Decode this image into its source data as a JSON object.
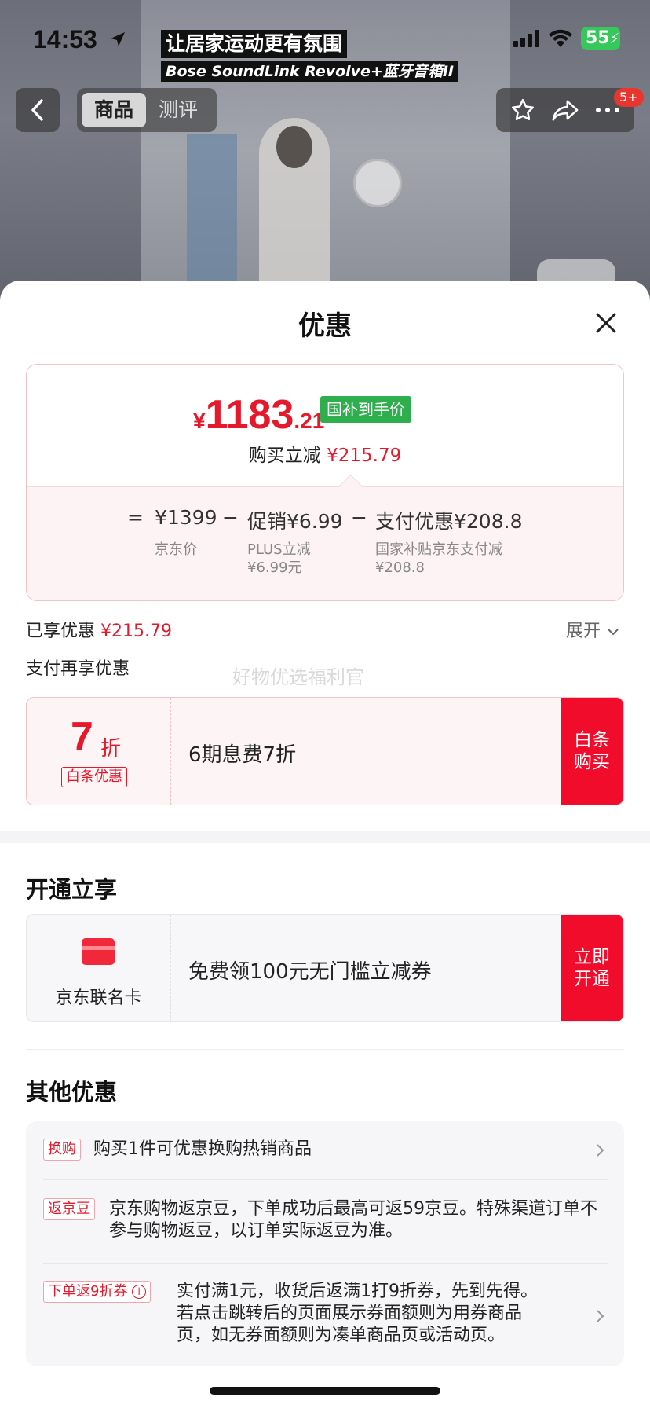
{
  "status_bar": {
    "time": "14:53",
    "battery": "55"
  },
  "video_caption": {
    "line1": "让居家运动更有氛围",
    "line2": "Bose SoundLink Revolve+蓝牙音箱II"
  },
  "top_nav": {
    "tabs": [
      {
        "label": "商品",
        "active": true
      },
      {
        "label": "测评",
        "active": false
      }
    ],
    "badge": "5+"
  },
  "sheet": {
    "title": "优惠",
    "price_card": {
      "currency": "¥",
      "price_int": "1183",
      "price_dec": ".21",
      "tag": "国补到手价",
      "reduce_label": "购买立减",
      "reduce_value": "¥215.79",
      "eq": "=",
      "jd_price": "¥1399",
      "jd_price_label": "京东价",
      "minus1": "−",
      "promo": "促销¥6.99",
      "promo_label_1": "PLUS立减",
      "promo_label_2": "¥6.99元",
      "minus2": "−",
      "pay": "支付优惠¥208.8",
      "pay_label_1": "国家补贴京东支付减",
      "pay_label_2": "¥208.8"
    },
    "enjoyed_label": "已享优惠",
    "enjoyed_value": "¥215.79",
    "expand": "展开",
    "pay_more": "支付再享优惠",
    "watermark": "好物优选福利官",
    "baitiao": {
      "discount": "7",
      "unit": "折",
      "tag": "白条优惠",
      "text": "6期息费7折",
      "button_line1": "白条",
      "button_line2": "购买"
    },
    "open_title": "开通立享",
    "cobrand": {
      "label": "京东联名卡",
      "text": "免费领100元无门槛立减券",
      "button_line1": "立即",
      "button_line2": "开通"
    },
    "other_title": "其他优惠",
    "other_items": [
      {
        "tag": "换购",
        "text": "购买1件可优惠换购热销商品"
      },
      {
        "tag": "返京豆",
        "text": "京东购物返京豆，下单成功后最高可返59京豆。特殊渠道订单不参与购物返豆，以订单实际返豆为准。"
      },
      {
        "tag": "下单返9折券",
        "text": "实付满1元，收货后返满1打9折券，先到先得。若点击跳转后的页面展示券面额则为用券商品页，如无券面额则为凑单商品页或活动页。"
      }
    ]
  }
}
